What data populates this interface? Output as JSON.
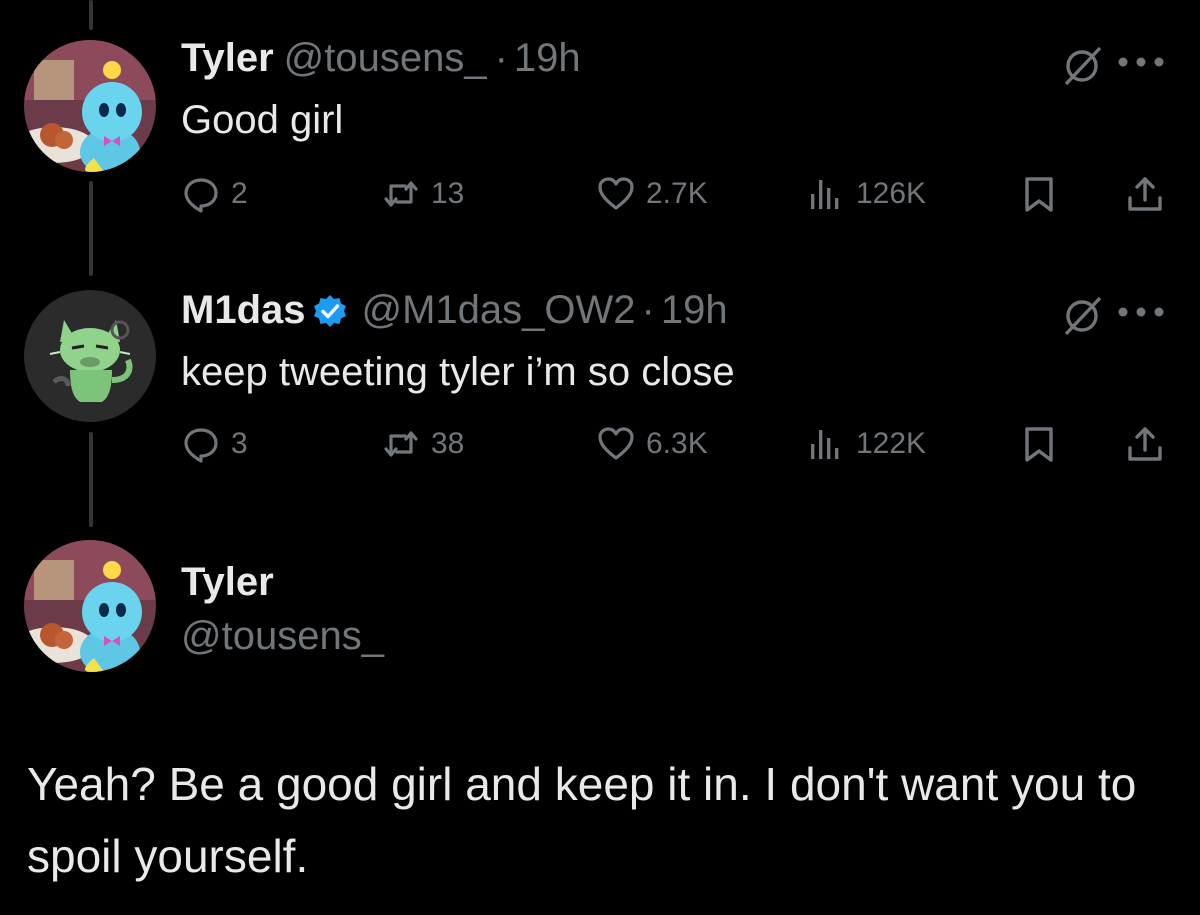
{
  "tweets": [
    {
      "name": "Tyler",
      "handle": "@tousens_",
      "sep": "·",
      "time": "19h",
      "text": "Good girl",
      "verified": false,
      "avatar": "chao-avatar",
      "stats": {
        "replies": "2",
        "retweets": "13",
        "likes": "2.7K",
        "views": "126K"
      }
    },
    {
      "name": "M1das",
      "handle": "@M1das_OW2",
      "sep": "·",
      "time": "19h",
      "text": "keep tweeting tyler i’m so close",
      "verified": true,
      "avatar": "sprigatito-avatar",
      "stats": {
        "replies": "3",
        "retweets": "38",
        "likes": "6.3K",
        "views": "122K"
      }
    }
  ],
  "main_tweet": {
    "name": "Tyler",
    "handle": "@tousens_",
    "text": "Yeah? Be a good girl and keep it in. I don't want you to spoil yourself."
  },
  "icons": {
    "reply": "reply-icon",
    "retweet": "retweet-icon",
    "like": "heart-icon",
    "views": "views-icon",
    "bookmark": "bookmark-icon",
    "share": "share-icon",
    "grok": "grok-icon",
    "more": "more-icon"
  },
  "colors": {
    "background": "#000000",
    "text": "#e7e9ea",
    "muted": "#71767b",
    "verified": "#1d9bf0",
    "thread_line": "#333639"
  }
}
